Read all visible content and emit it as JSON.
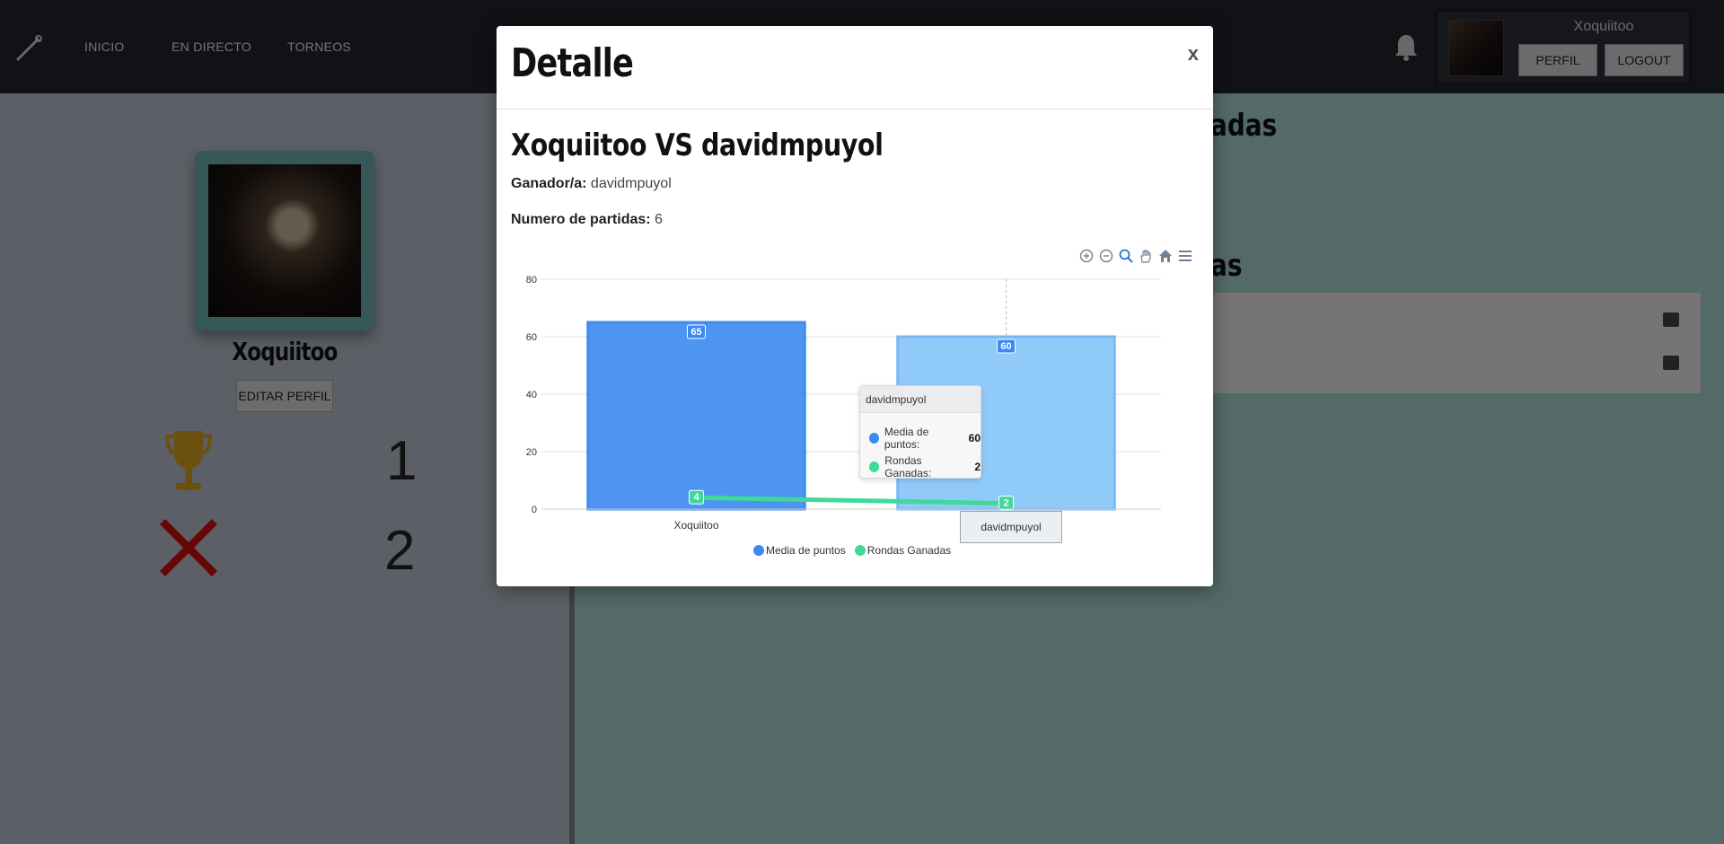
{
  "nav": {
    "links": [
      "INICIO",
      "EN DIRECTO",
      "TORNEOS"
    ],
    "user": {
      "name": "Xoquiitoo",
      "perfil_label": "PERFIL",
      "logout_label": "LOGOUT"
    }
  },
  "profile": {
    "name": "Xoquiitoo",
    "edit_label": "EDITAR PERFIL",
    "wins": "1",
    "losses": "2"
  },
  "background": {
    "title_partial_1": "adas",
    "title_partial_2": "as"
  },
  "modal": {
    "title": "Detalle",
    "close_label": "x",
    "match_title": "Xoquiitoo VS davidmpuyol",
    "winner_label": "Ganador/a:",
    "winner_value": "davidmpuyol",
    "games_label": "Numero de partidas:",
    "games_value": "6"
  },
  "tooltip": {
    "title": "davidmpuyol",
    "rows": [
      {
        "label": "Media de puntos:",
        "value": "60",
        "color": "#3b8af2"
      },
      {
        "label": "Rondas Ganadas:",
        "value": "2",
        "color": "#3fd99a"
      }
    ]
  },
  "hover_x_label": "davidmpuyol",
  "chart_data": {
    "type": "bar",
    "categories": [
      "Xoquiitoo",
      "davidmpuyol"
    ],
    "series": [
      {
        "name": "Media de puntos",
        "type": "bar",
        "values": [
          65,
          60
        ],
        "color": "#3b8af2"
      },
      {
        "name": "Rondas Ganadas",
        "type": "line",
        "values": [
          4,
          2
        ],
        "color": "#3fd99a"
      }
    ],
    "yticks": [
      0,
      20,
      40,
      60,
      80
    ],
    "ylim": [
      0,
      80
    ],
    "grid": true,
    "legend_position": "bottom",
    "highlighted_category": "davidmpuyol",
    "highlight_color": "#90caf9"
  }
}
